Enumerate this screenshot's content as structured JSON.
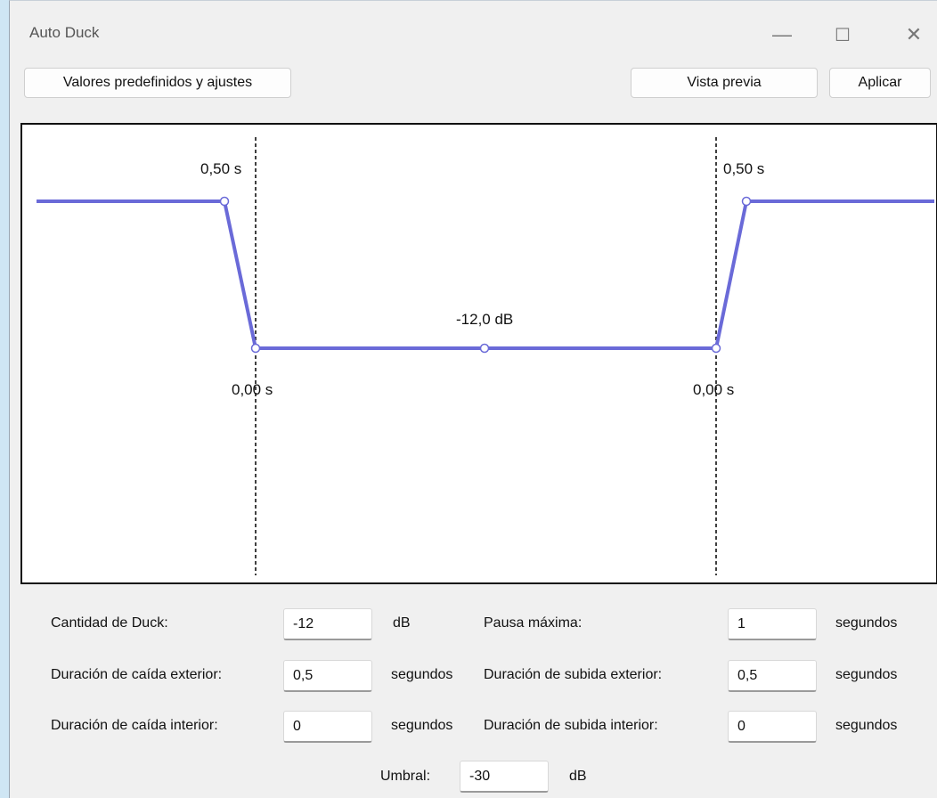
{
  "window": {
    "title": "Auto Duck",
    "minimize_glyph": "—",
    "maximize_glyph": "☐",
    "close_glyph": "✕"
  },
  "toolbar": {
    "presets_label": "Valores predefinidos y ajustes",
    "preview_label": "Vista previa",
    "apply_label": "Aplicar"
  },
  "graph": {
    "outer_fade_down_label": "0,50 s",
    "outer_fade_up_label": "0,50 s",
    "inner_fade_down_label": "0,00 s",
    "inner_fade_up_label": "0,00 s",
    "duck_amount_label": "-12,0 dB",
    "line_color": "#6a6ad8"
  },
  "params": {
    "duck_amount": {
      "label": "Cantidad de Duck:",
      "value": "-12",
      "unit": "dB"
    },
    "max_pause": {
      "label": "Pausa máxima:",
      "value": "1",
      "unit": "segundos"
    },
    "outer_fade_down": {
      "label": "Duración de caída exterior:",
      "value": "0,5",
      "unit": "segundos"
    },
    "outer_fade_up": {
      "label": "Duración de subida exterior:",
      "value": "0,5",
      "unit": "segundos"
    },
    "inner_fade_down": {
      "label": "Duración de caída interior:",
      "value": "0",
      "unit": "segundos"
    },
    "inner_fade_up": {
      "label": "Duración de subida interior:",
      "value": "0",
      "unit": "segundos"
    },
    "threshold": {
      "label": "Umbral:",
      "value": "-30",
      "unit": "dB"
    }
  }
}
